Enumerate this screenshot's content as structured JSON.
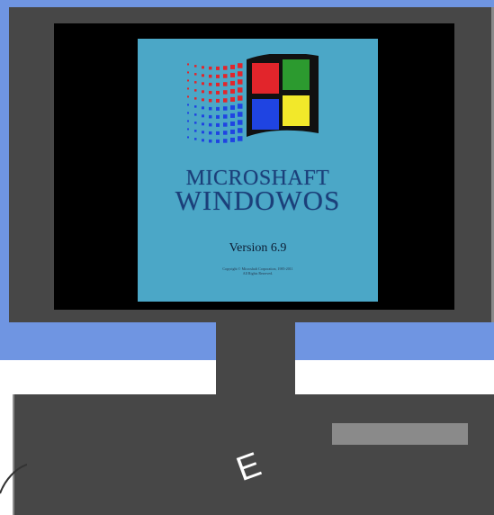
{
  "colors": {
    "wall": "#6f95e2",
    "floor": "#ffffff",
    "monitor_body": "#474747",
    "screen_background": "#000000",
    "splash_background": "#4ba7c7",
    "title_text": "#1b3f7a",
    "flag_red": "#e2252b",
    "flag_green": "#2c9a2f",
    "flag_blue": "#1f44e2",
    "flag_yellow": "#f2e82a",
    "drive_slot": "#8a8a8a"
  },
  "splash": {
    "title_line1": "MICROSHAFT",
    "title_line2": "WINDOWOS",
    "version": "Version 6.9",
    "copyright_line1": "Copyright © Microshaft Corporation, 1985-2011",
    "copyright_line2": "All Rights Reserved."
  },
  "base": {
    "letter": "E"
  }
}
